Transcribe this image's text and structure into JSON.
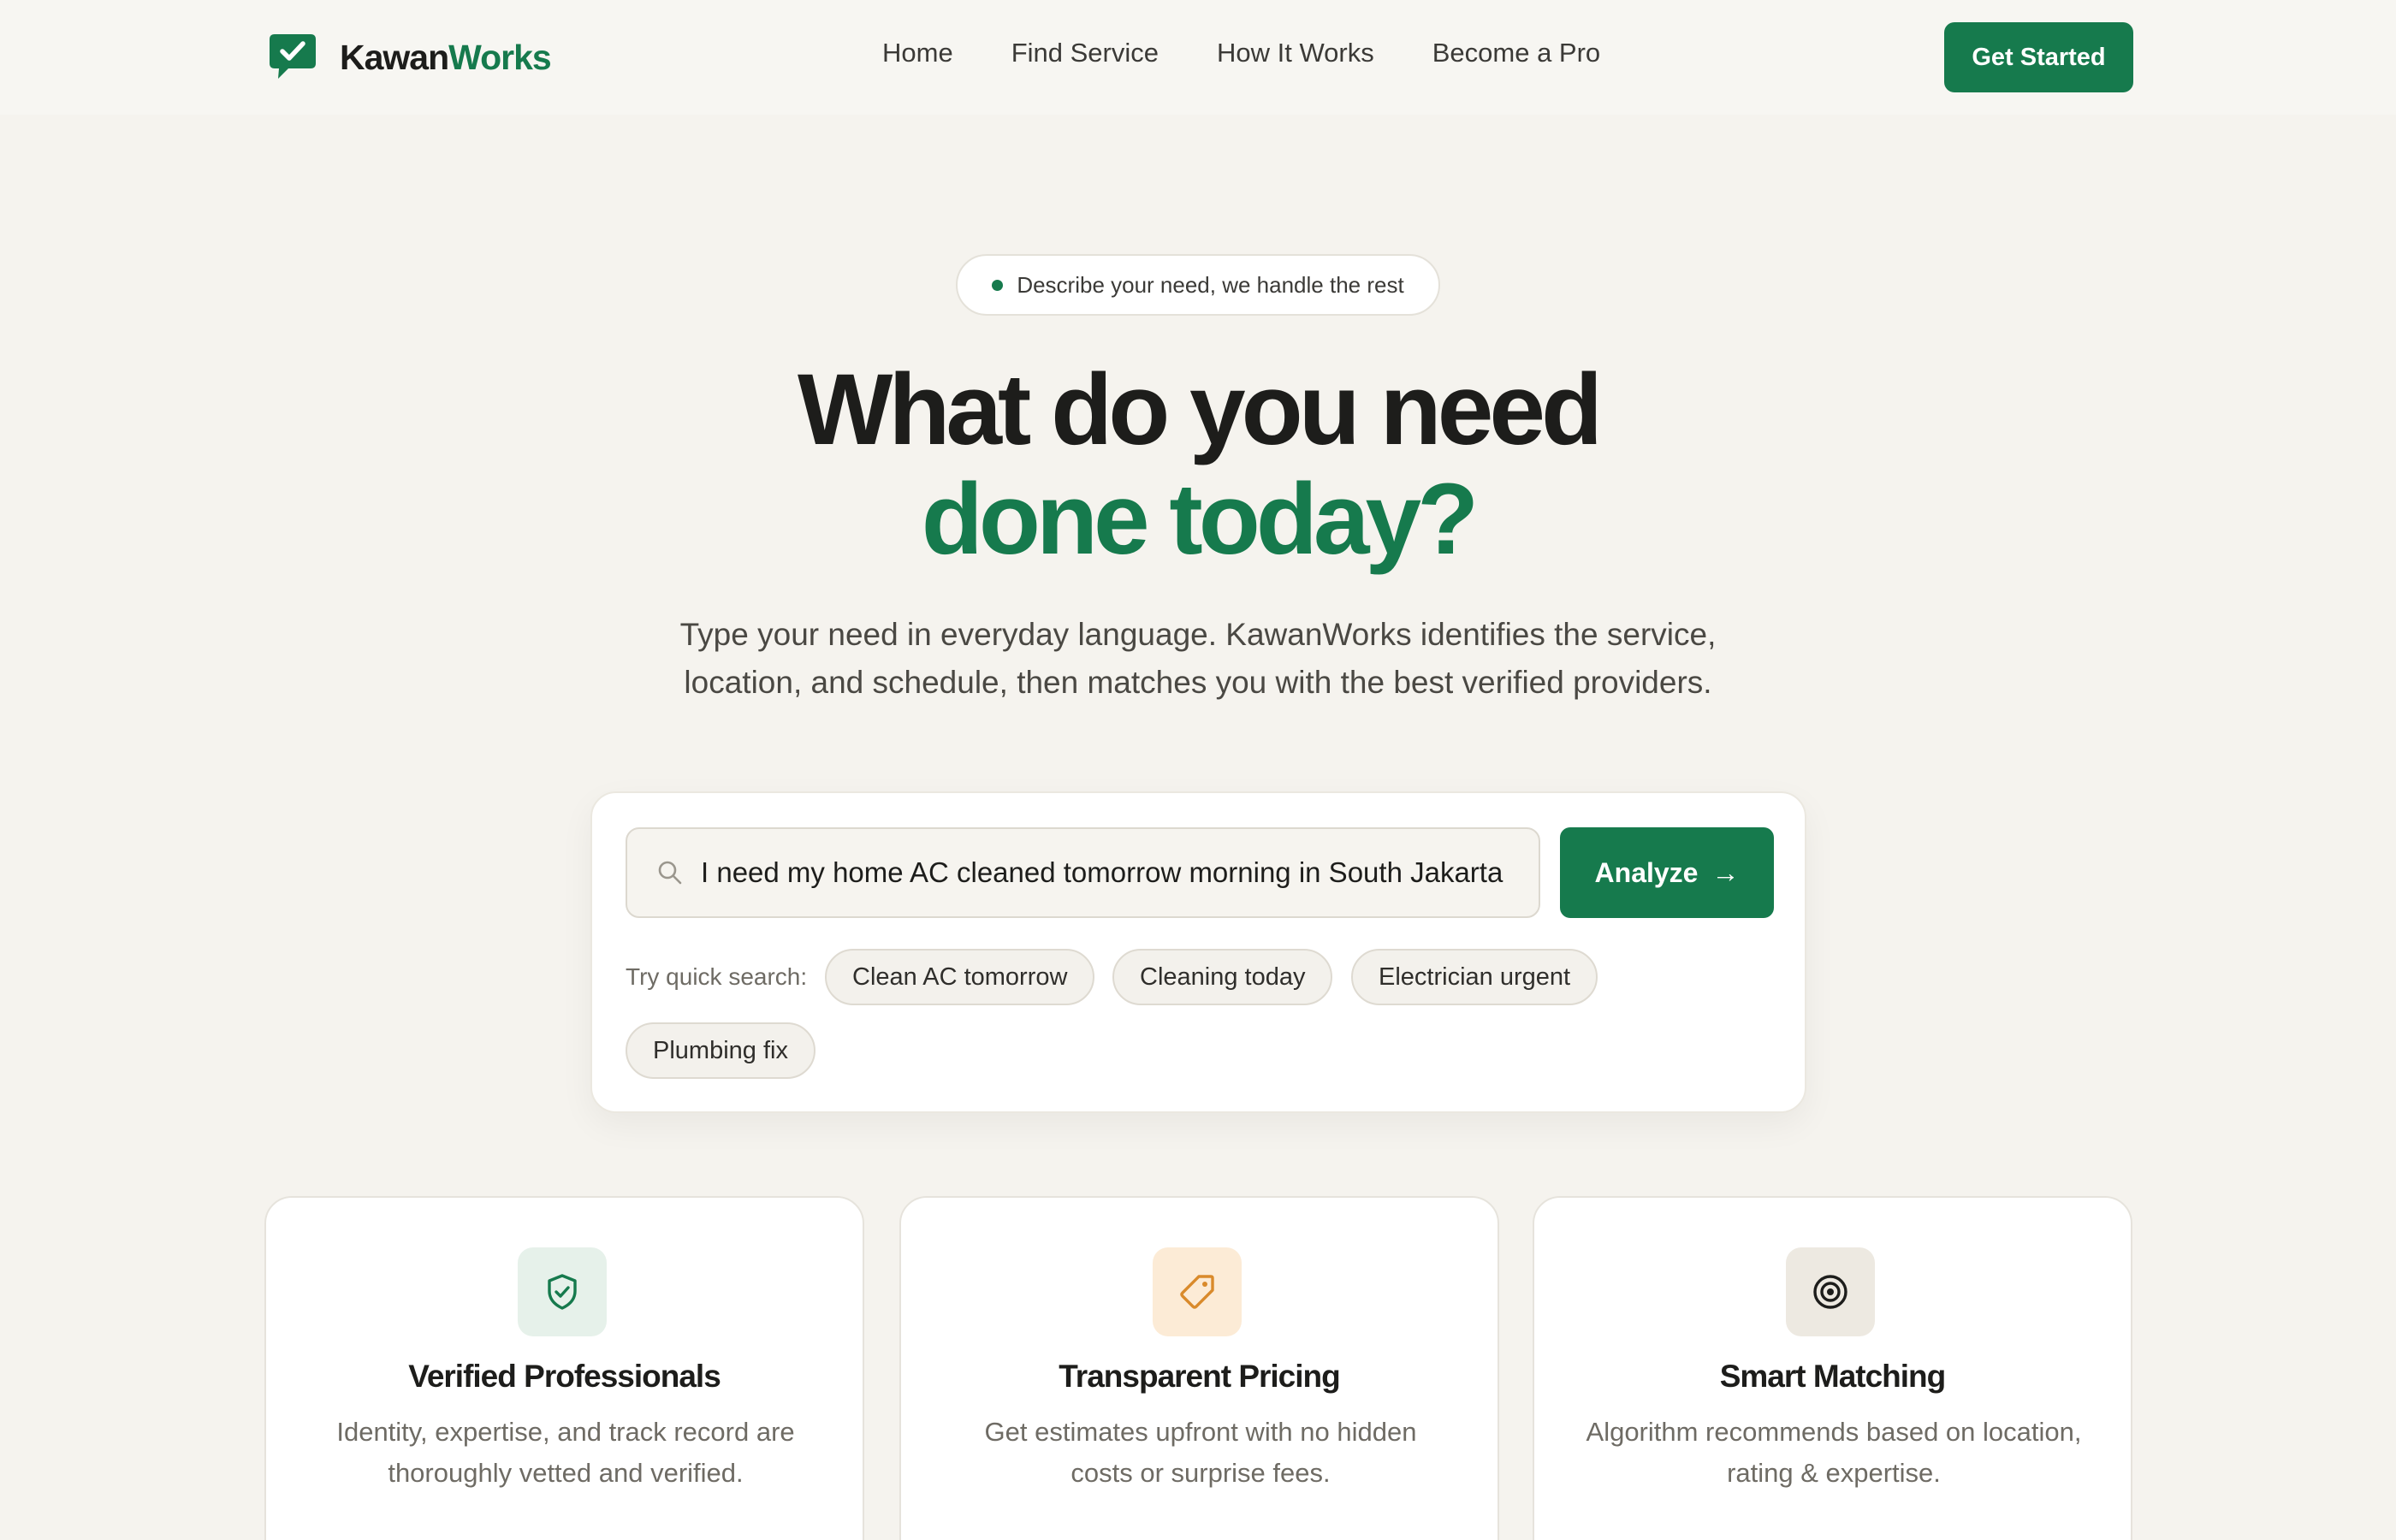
{
  "nav": {
    "brand_primary": "Kawan",
    "brand_accent": "Works",
    "links": [
      "Home",
      "Find Service",
      "How It Works",
      "Become a Pro"
    ],
    "cta_label": "Get Started"
  },
  "hero": {
    "badge": "Describe your need, we handle the rest",
    "headline_line1": "What do you need",
    "headline_line2": "done today?",
    "subtitle_line1": "Type your need in everyday language. KawanWorks identifies the service,",
    "subtitle_line2": "location, and schedule, then matches you with the best verified providers."
  },
  "search": {
    "value": "I need my home AC cleaned tomorrow morning in South Jakarta",
    "analyze_label": "Analyze",
    "analyze_arrow": "→",
    "quick_label": "Try quick search:",
    "chips": [
      "Clean AC tomorrow",
      "Cleaning today",
      "Electrician urgent",
      "Plumbing fix"
    ]
  },
  "features": [
    {
      "icon": "shield-check-icon",
      "title": "Verified Professionals",
      "desc_line1": "Identity, expertise, and track record are",
      "desc_line2": "thoroughly vetted and verified."
    },
    {
      "icon": "tag-icon",
      "title": "Transparent Pricing",
      "desc_line1": "Get estimates upfront with no hidden",
      "desc_line2": "costs or surprise fees."
    },
    {
      "icon": "target-icon",
      "title": "Smart Matching",
      "desc_line1": "Algorithm recommends based on location,",
      "desc_line2": "rating & expertise."
    }
  ],
  "colors": {
    "brand_green": "#167a4d",
    "background": "#f5f3ee",
    "pricing_icon_bg": "#fcebd6",
    "pricing_icon": "#d98a2b",
    "verified_icon_bg": "#e6f1ea",
    "matching_icon_bg": "#ede9e1"
  }
}
